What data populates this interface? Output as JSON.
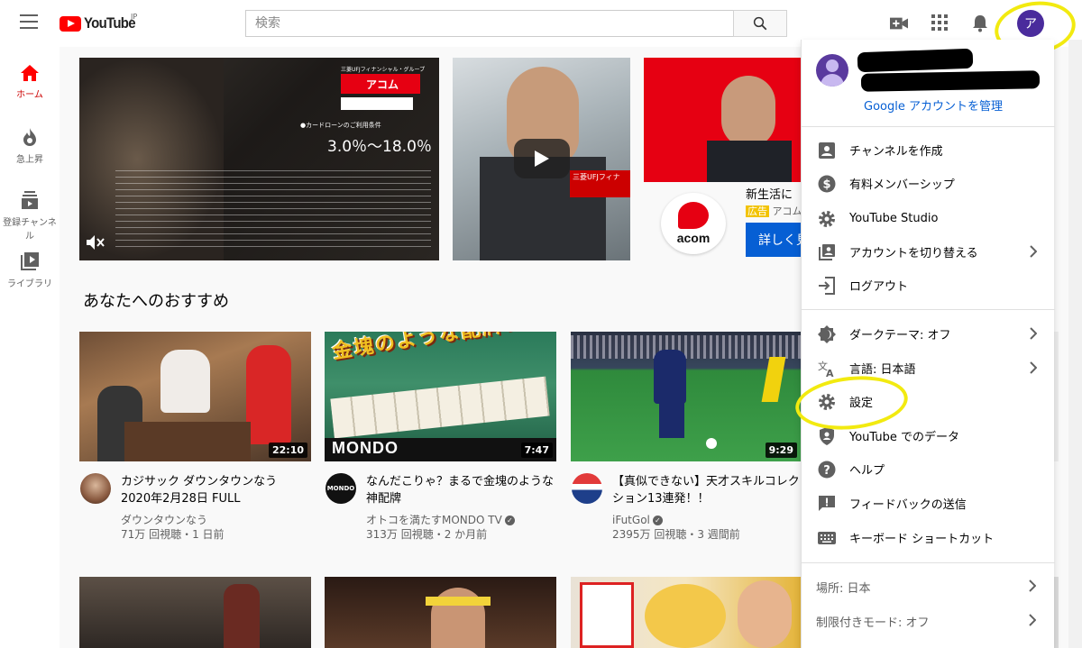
{
  "header": {
    "logo_text": "YouTube",
    "logo_region": "JP",
    "search_placeholder": "検索",
    "avatar_letter": "ア"
  },
  "guide": [
    {
      "label": "ホーム",
      "icon": "home-icon",
      "active": true
    },
    {
      "label": "急上昇",
      "icon": "trending-icon",
      "active": false
    },
    {
      "label": "登録チャンネル",
      "icon": "subscriptions-icon",
      "active": false
    },
    {
      "label": "ライブラリ",
      "icon": "library-icon",
      "active": false
    }
  ],
  "ad_banner": {
    "brand_top": "三菱UFJフィナンシャル・グループ",
    "brand": "アコム",
    "rate_label": "●カードローンのご利用条件",
    "rate": "3.0％〜18.0％",
    "brand_side": "三菱UFJフィナ",
    "logo_text": "acom",
    "caption": "新生活に",
    "ad_badge": "広告",
    "ad_channel": "アコム",
    "cta": "詳しく見"
  },
  "section_title": "あなたへのおすすめ",
  "videos": [
    {
      "title": "カジサック ダウンタウンなう 2020年2月28日 FULL",
      "channel": "ダウンタウンなう",
      "verified": false,
      "meta": "71万 回視聴・1 日前",
      "duration": "22:10"
    },
    {
      "title": "なんだこりゃ？まるで金塊のような神配牌",
      "channel": "オトコを満たすMONDO TV",
      "verified": true,
      "meta": "313万 回視聴・2 か月前",
      "duration": "7:47",
      "thumb_text": "金塊のような配牌!!",
      "thumb_brand": "MONDO"
    },
    {
      "title": "【真似できない】天才スキルコレクション13連発！！",
      "channel": "iFutGol",
      "verified": true,
      "meta": "2395万 回視聴・3 週間前",
      "duration": "9:29"
    }
  ],
  "account_menu": {
    "manage_account": "Google アカウントを管理",
    "items_a": [
      {
        "label": "チャンネルを作成",
        "icon": "account-box-icon",
        "chevron": false
      },
      {
        "label": "有料メンバーシップ",
        "icon": "dollar-icon",
        "chevron": false
      },
      {
        "label": "YouTube Studio",
        "icon": "gear-icon",
        "chevron": false
      },
      {
        "label": "アカウントを切り替える",
        "icon": "switch-account-icon",
        "chevron": true
      },
      {
        "label": "ログアウト",
        "icon": "logout-icon",
        "chevron": false
      }
    ],
    "items_b": [
      {
        "label": "ダークテーマ: オフ",
        "icon": "dark-theme-icon",
        "chevron": true
      },
      {
        "label": "言語: 日本語",
        "icon": "translate-icon",
        "chevron": true
      },
      {
        "label": "設定",
        "icon": "settings-icon",
        "chevron": false
      },
      {
        "label": "YouTube でのデータ",
        "icon": "shield-user-icon",
        "chevron": false
      },
      {
        "label": "ヘルプ",
        "icon": "help-icon",
        "chevron": false
      },
      {
        "label": "フィードバックの送信",
        "icon": "feedback-icon",
        "chevron": false
      },
      {
        "label": "キーボード ショートカット",
        "icon": "keyboard-icon",
        "chevron": false
      }
    ],
    "footer": [
      {
        "label": "場所: 日本"
      },
      {
        "label": "制限付きモード: オフ"
      }
    ]
  },
  "colors": {
    "brand_red": "#ff0000",
    "link_blue": "#065fd4",
    "highlight_yellow": "#f2ea10",
    "avatar_purple": "#4a2b9c"
  }
}
